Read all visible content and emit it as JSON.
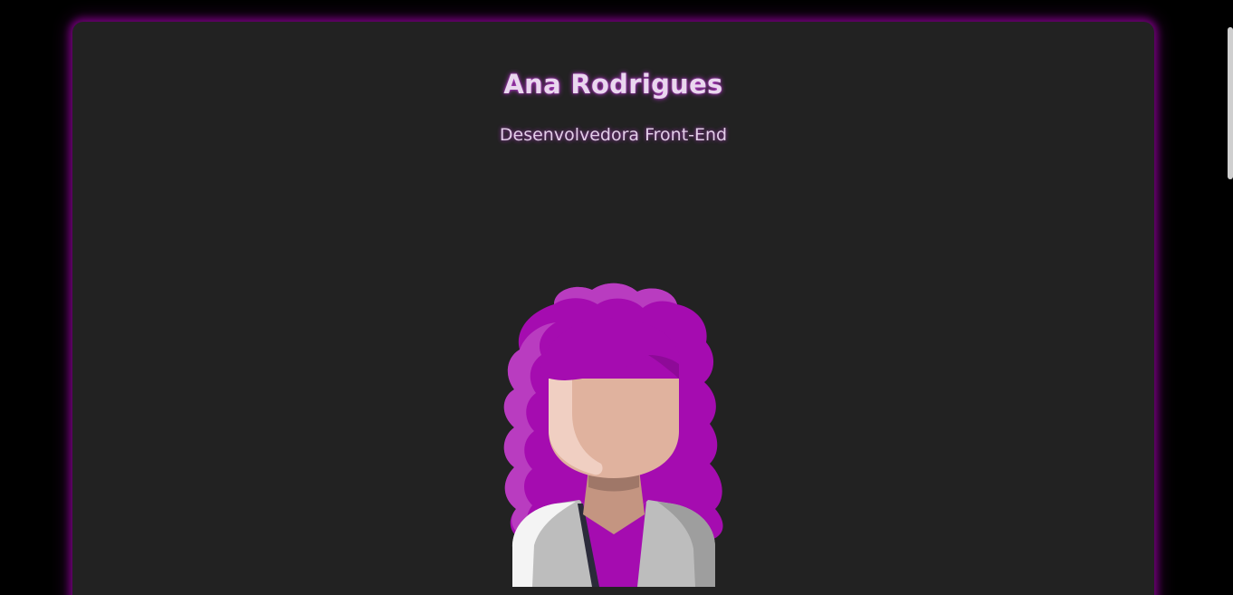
{
  "profile": {
    "name": "Ana Rodrigues",
    "role": "Desenvolvedora Front-End"
  },
  "avatar": {
    "icon": "woman-avatar-icon"
  },
  "colors": {
    "background": "#000000",
    "card": "#222222",
    "glow": "#aa00b4",
    "hair": "#a50cb0",
    "hair_highlight": "#b93cc0",
    "skin": "#e0b29e",
    "skin_highlight": "#f0cfc2",
    "neck": "#c49581",
    "neck_shadow": "#9f7768",
    "coat": "#bdbdbd",
    "coat_dark": "#9e9e9e",
    "coat_light": "#f4f4f4",
    "shirt": "#a50cb0"
  }
}
